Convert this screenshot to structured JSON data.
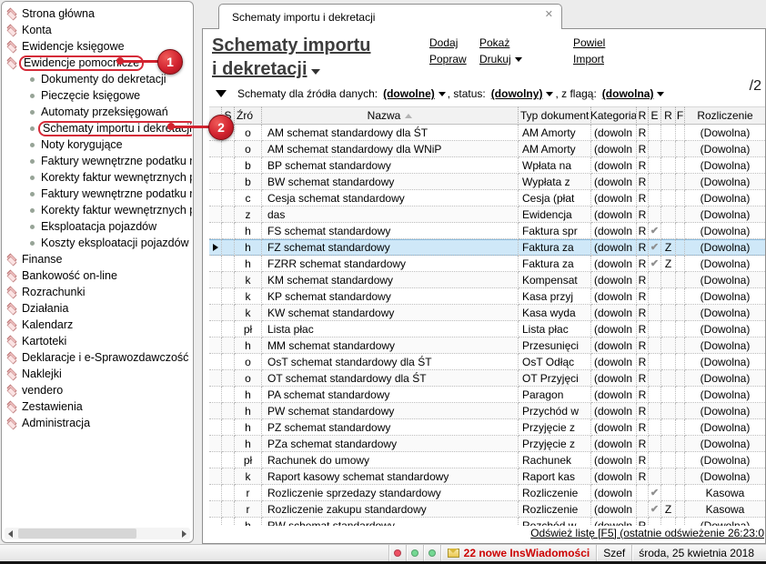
{
  "sidebar": {
    "items": [
      {
        "label": "Strona główna",
        "level": "root",
        "icon": "home-icon"
      },
      {
        "label": "Konta",
        "level": "root",
        "icon": "accounts-icon"
      },
      {
        "label": "Ewidencje księgowe",
        "level": "root",
        "icon": "ledgers-icon"
      },
      {
        "label": "Ewidencje pomocnicze",
        "level": "root",
        "icon": "aux-ledgers-icon",
        "annotation": "1"
      },
      {
        "label": "Dokumenty do dekretacji",
        "level": "child"
      },
      {
        "label": "Pieczęcie księgowe",
        "level": "child"
      },
      {
        "label": "Automaty przeksięgowań",
        "level": "child"
      },
      {
        "label": "Schematy importu i dekretacji",
        "level": "child",
        "annotation": "2"
      },
      {
        "label": "Noty korygujące",
        "level": "child"
      },
      {
        "label": "Faktury wewnętrzne podatku n",
        "level": "child"
      },
      {
        "label": "Korekty faktur wewnętrznych p",
        "level": "child"
      },
      {
        "label": "Faktury wewnętrzne podatku n",
        "level": "child"
      },
      {
        "label": "Korekty faktur wewnętrznych p",
        "level": "child"
      },
      {
        "label": "Eksploatacja pojazdów",
        "level": "child"
      },
      {
        "label": "Koszty eksploatacji pojazdów",
        "level": "child"
      },
      {
        "label": "Finanse",
        "level": "root",
        "icon": "finance-icon"
      },
      {
        "label": "Bankowość on-line",
        "level": "root",
        "icon": "banking-icon"
      },
      {
        "label": "Rozrachunki",
        "level": "root",
        "icon": "settlements-icon"
      },
      {
        "label": "Działania",
        "level": "root",
        "icon": "actions-icon"
      },
      {
        "label": "Kalendarz",
        "level": "root",
        "icon": "calendar-icon"
      },
      {
        "label": "Kartoteki",
        "level": "root",
        "icon": "records-icon"
      },
      {
        "label": "Deklaracje i e-Sprawozdawczość",
        "level": "root",
        "icon": "declarations-icon"
      },
      {
        "label": "Naklejki",
        "level": "root",
        "icon": "labels-icon"
      },
      {
        "label": "vendero",
        "level": "root",
        "icon": "vendero-icon"
      },
      {
        "label": "Zestawienia",
        "level": "root",
        "icon": "reports-icon"
      },
      {
        "label": "Administracja",
        "level": "root",
        "icon": "admin-icon"
      }
    ]
  },
  "tab": {
    "label": "Schematy importu i dekretacji",
    "close_icon": "✕"
  },
  "header": {
    "title_line1": "Schematy importu",
    "title_line2": "i dekretacji"
  },
  "toolbar": {
    "columns": [
      [
        {
          "label": "Dodaj"
        },
        {
          "label": "Popraw"
        }
      ],
      [
        {
          "label": "Pokaż"
        },
        {
          "label": "Drukuj",
          "caret": true
        }
      ],
      [
        {
          "label": "Powiel"
        },
        {
          "label": "Import"
        }
      ]
    ]
  },
  "filter": {
    "label": "Schematy dla źródła danych:",
    "dropdowns": [
      {
        "prefix": "",
        "value": "(dowolne)"
      },
      {
        "prefix": ", status:",
        "value": "(dowolny)"
      },
      {
        "prefix": ", z flagą:",
        "value": "(dowolna)"
      }
    ]
  },
  "counter": "/2",
  "table": {
    "columns": [
      {
        "label": ""
      },
      {
        "label": "S"
      },
      {
        "label": "Źró"
      },
      {
        "label": "Nazwa",
        "sort": "asc"
      },
      {
        "label": "Typ dokument"
      },
      {
        "label": "Kategoria"
      },
      {
        "label": "R"
      },
      {
        "label": "E"
      },
      {
        "label": "R"
      },
      {
        "label": "F"
      },
      {
        "label": "Rozliczenie"
      }
    ],
    "selected_index": 7,
    "rows": [
      [
        "o",
        "AM schemat standardowy dla ŚT",
        "AM Amorty",
        "(dowoln",
        "R",
        "",
        "",
        "",
        "(Dowolna)"
      ],
      [
        "o",
        "AM schemat standardowy dla WNiP",
        "AM Amorty",
        "(dowoln",
        "R",
        "",
        "",
        "",
        "(Dowolna)"
      ],
      [
        "b",
        "BP schemat standardowy",
        "Wpłata na",
        "(dowoln",
        "R",
        "",
        "",
        "",
        "(Dowolna)"
      ],
      [
        "b",
        "BW schemat standardowy",
        "Wypłata z",
        "(dowoln",
        "R",
        "",
        "",
        "",
        "(Dowolna)"
      ],
      [
        "c",
        "Cesja schemat standardowy",
        "Cesja (płat",
        "(dowoln",
        "R",
        "",
        "",
        "",
        "(Dowolna)"
      ],
      [
        "z",
        "das",
        "Ewidencja",
        "(dowoln",
        "R",
        "",
        "",
        "",
        "(Dowolna)"
      ],
      [
        "h",
        "FS schemat standardowy",
        "Faktura spr",
        "(dowoln",
        "R",
        "✔",
        "",
        "",
        "(Dowolna)"
      ],
      [
        "h",
        "FZ schemat standardowy",
        "Faktura za",
        "(dowoln",
        "R",
        "✔",
        "Z",
        "",
        "(Dowolna)"
      ],
      [
        "h",
        "FZRR schemat standardowy",
        "Faktura za",
        "(dowoln",
        "R",
        "✔",
        "Z",
        "",
        "(Dowolna)"
      ],
      [
        "k",
        "KM schemat standardowy",
        "Kompensat",
        "(dowoln",
        "R",
        "",
        "",
        "",
        "(Dowolna)"
      ],
      [
        "k",
        "KP schemat standardowy",
        "Kasa przyj",
        "(dowoln",
        "R",
        "",
        "",
        "",
        "(Dowolna)"
      ],
      [
        "k",
        "KW schemat standardowy",
        "Kasa wyda",
        "(dowoln",
        "R",
        "",
        "",
        "",
        "(Dowolna)"
      ],
      [
        "pł",
        "Lista płac",
        "Lista płac",
        "(dowoln",
        "R",
        "",
        "",
        "",
        "(Dowolna)"
      ],
      [
        "h",
        "MM schemat standardowy",
        "Przesunięci",
        "(dowoln",
        "R",
        "",
        "",
        "",
        "(Dowolna)"
      ],
      [
        "o",
        "OsT schemat standardowy dla ŚT",
        "OsT Odłąc",
        "(dowoln",
        "R",
        "",
        "",
        "",
        "(Dowolna)"
      ],
      [
        "o",
        "OT schemat standardowy dla ŚT",
        "OT Przyjęci",
        "(dowoln",
        "R",
        "",
        "",
        "",
        "(Dowolna)"
      ],
      [
        "h",
        "PA schemat standardowy",
        "Paragon",
        "(dowoln",
        "R",
        "",
        "",
        "",
        "(Dowolna)"
      ],
      [
        "h",
        "PW schemat standardowy",
        "Przychód w",
        "(dowoln",
        "R",
        "",
        "",
        "",
        "(Dowolna)"
      ],
      [
        "h",
        "PZ schemat standardowy",
        "Przyjęcie z",
        "(dowoln",
        "R",
        "",
        "",
        "",
        "(Dowolna)"
      ],
      [
        "h",
        "PZa schemat standardowy",
        "Przyjęcie z",
        "(dowoln",
        "R",
        "",
        "",
        "",
        "(Dowolna)"
      ],
      [
        "pł",
        "Rachunek do umowy",
        "Rachunek",
        "(dowoln",
        "R",
        "",
        "",
        "",
        "(Dowolna)"
      ],
      [
        "k",
        "Raport kasowy schemat standardowy",
        "Raport kas",
        "(dowoln",
        "R",
        "",
        "",
        "",
        "(Dowolna)"
      ],
      [
        "r",
        "Rozliczenie sprzedazy standardowy",
        "Rozliczenie",
        "(dowoln",
        "",
        "✔",
        "",
        "",
        "Kasowa"
      ],
      [
        "r",
        "Rozliczenie zakupu standardowy",
        "Rozliczenie",
        "(dowoln",
        "",
        "✔",
        "Z",
        "",
        "Kasowa"
      ],
      [
        "h",
        "RW schemat standardowy",
        "Rozchód w",
        "(dowoln",
        "R",
        "",
        "",
        "",
        "(Dowolna)"
      ]
    ]
  },
  "footer": {
    "refresh_label": "Odśwież listę [F5] (ostatnie odświeżenie 26:23:0"
  },
  "statusbar": {
    "indicators": [
      {
        "name": "indicator-red",
        "color": "#ee4f63"
      },
      {
        "name": "indicator-green-1",
        "color": "#74d893"
      },
      {
        "name": "indicator-green-2",
        "color": "#74d893"
      }
    ],
    "mail_message": "22 nowe InsWiadomości",
    "user": "Szef",
    "date": "środa, 25 kwietnia 2018"
  },
  "annotations": {
    "badge1": "1",
    "badge2": "2"
  },
  "colors": {
    "selection_bg": "#cfe8f8",
    "selection_border": "#8abbdd",
    "annotation_red": "#d2232f",
    "alert_text": "#cc0000",
    "title_text": "#3d3d3d"
  }
}
